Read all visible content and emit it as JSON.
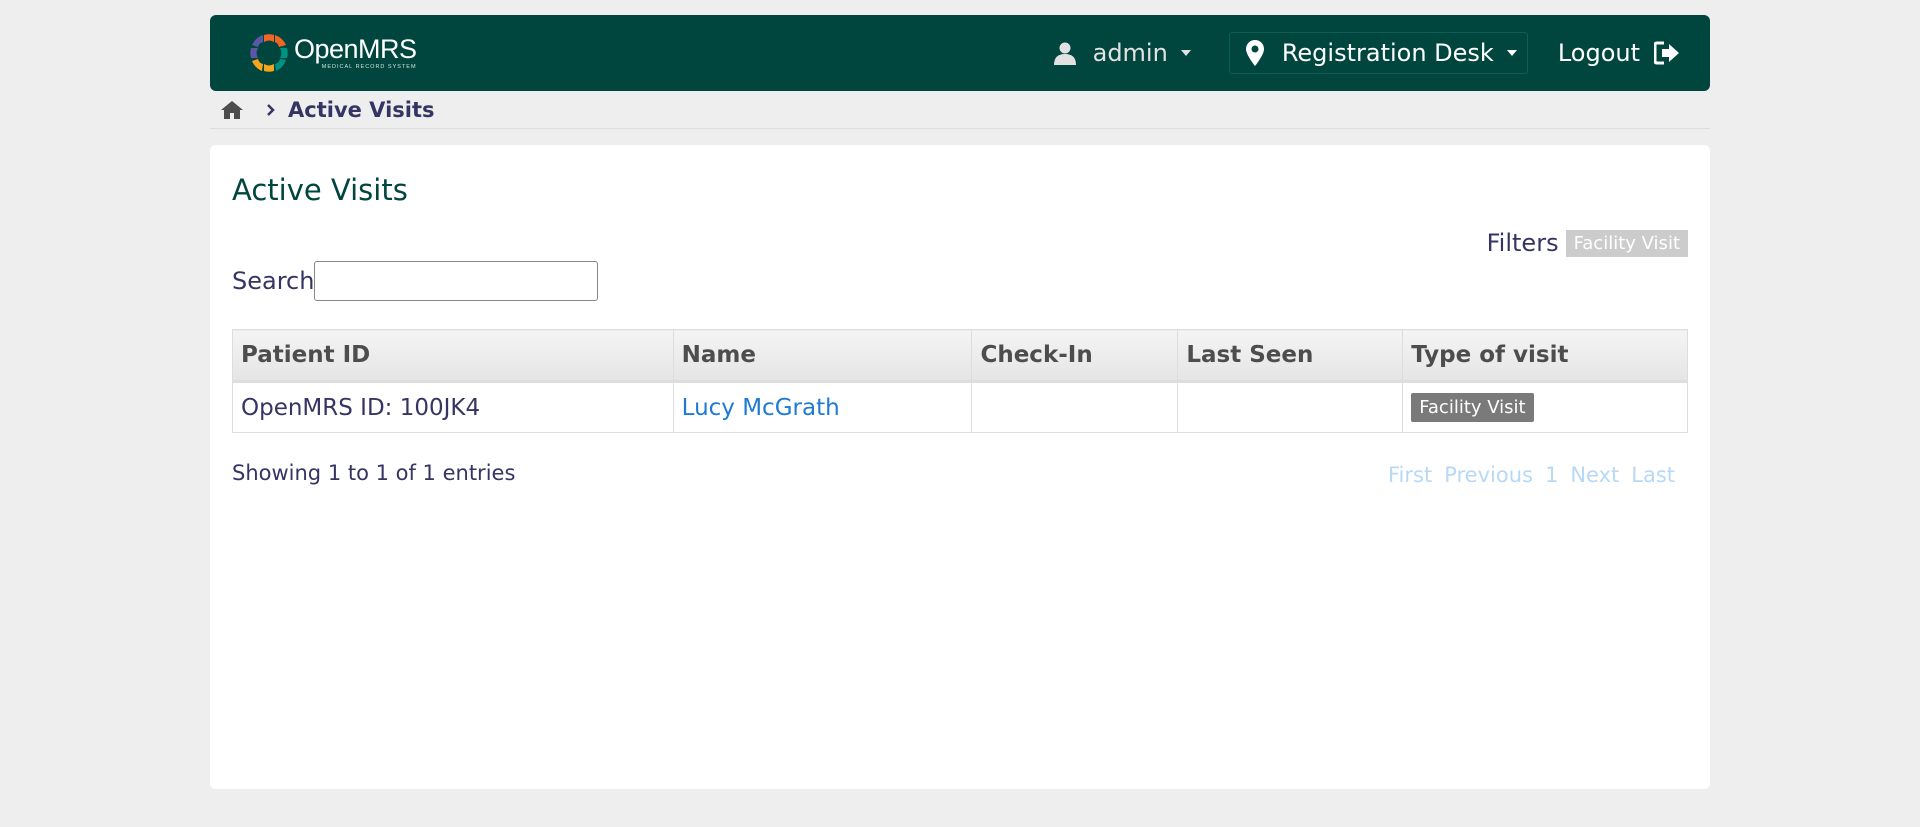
{
  "header": {
    "brand_name": "OpenMRS",
    "brand_tagline": "MEDICAL RECORD SYSTEM",
    "user": "admin",
    "location": "Registration Desk",
    "logout": "Logout"
  },
  "breadcrumb": {
    "current": "Active Visits"
  },
  "page": {
    "title": "Active Visits",
    "filters_label": "Filters",
    "filter_tag": "Facility Visit",
    "search_label": "Search",
    "search_value": ""
  },
  "table": {
    "columns": [
      "Patient ID",
      "Name",
      "Check-In",
      "Last Seen",
      "Type of visit"
    ],
    "rows": [
      {
        "patient_id": "OpenMRS ID: 100JK4",
        "name": "Lucy McGrath",
        "check_in": "",
        "last_seen": "",
        "type_of_visit": "Facility Visit"
      }
    ]
  },
  "footer": {
    "info": "Showing 1 to 1 of 1 entries",
    "pager": {
      "first": "First",
      "previous": "Previous",
      "page": "1",
      "next": "Next",
      "last": "Last"
    }
  },
  "colors": {
    "header_bg": "#00463f",
    "link": "#1f7ad4",
    "text": "#363463",
    "pager_disabled": "#b7d9f5",
    "badge": "#7a7a7a"
  },
  "icons": {
    "brand": "openmrs-logo-icon",
    "user": "user-icon",
    "location": "map-marker-icon",
    "logout": "sign-out-icon",
    "home": "home-icon",
    "separator": "chevron-right-icon"
  }
}
